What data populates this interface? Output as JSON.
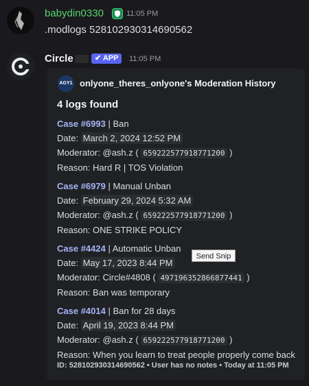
{
  "message1": {
    "username": "babydin0330",
    "time": "11:05 PM",
    "content": ".modlogs 528102930314690562"
  },
  "message2": {
    "username": "Circle",
    "app_badge": "✔ APP",
    "time": "11:05 PM",
    "embed": {
      "author_icon_text": "AGY1",
      "author_name": "onlyone_theres_onlyone's Moderation History",
      "title": "4 logs found",
      "cases": [
        {
          "case_label": "Case #6993",
          "action": "| Ban",
          "date_label": "Date:",
          "date": "March 2, 2024 12:52 PM",
          "mod_label": "Moderator:",
          "moderator": "@ash.z",
          "mod_id": "659222577918771200",
          "reason": "Reason: Hard R | TOS Violation"
        },
        {
          "case_label": "Case #6979",
          "action": "| Manual Unban",
          "date_label": "Date:",
          "date": "February 29, 2024 5:32 AM",
          "mod_label": "Moderator:",
          "moderator": "@ash.z",
          "mod_id": "659222577918771200",
          "reason": "Reason: ONE STRIKE POLICY"
        },
        {
          "case_label": "Case #4424",
          "action": "| Automatic Unban",
          "date_label": "Date:",
          "date": "May 17, 2023 8:44 PM",
          "mod_label": "Moderator:",
          "moderator": "Circle#4808",
          "mod_id": "497196352866877441",
          "reason": "Reason: Ban was temporary"
        },
        {
          "case_label": "Case #4014",
          "action": "| Ban for 28 days",
          "date_label": "Date:",
          "date": "April 19, 2023 8:44 PM",
          "mod_label": "Moderator:",
          "moderator": "@ash.z",
          "mod_id": "659222577918771200",
          "reason": "Reason: When you learn to treat people properly come back"
        }
      ],
      "footer": "ID: 528102930314690562 • User has no notes • Today at 11:05 PM"
    }
  },
  "tooltip": "Send Snip",
  "colors": {
    "background": "#1a1a1e",
    "username1": "#57d46e",
    "link": "#a4b4f6",
    "app_badge": "#5865f2"
  }
}
